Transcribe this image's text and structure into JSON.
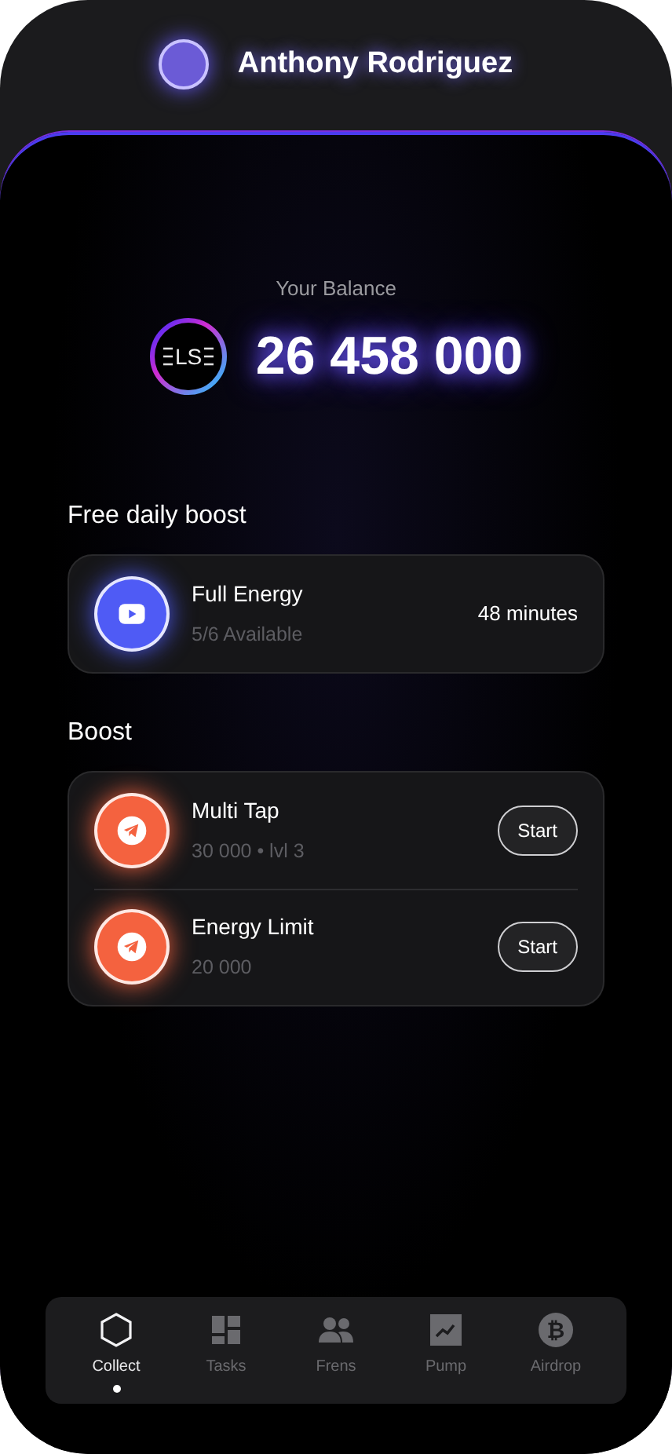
{
  "user": {
    "name": "Anthony Rodriguez"
  },
  "balance": {
    "label": "Your Balance",
    "coin_mark": "LS",
    "amount": "26 458 000"
  },
  "free_boost": {
    "title": "Free daily boost",
    "items": [
      {
        "kind": "timer",
        "color": "#4f5bf5",
        "title": "Full Energy",
        "subtitle": "5/6 Available",
        "status": "48 minutes"
      }
    ]
  },
  "boost": {
    "title": "Boost",
    "items": [
      {
        "kind": "button",
        "color": "#f4623f",
        "title": "Multi Tap",
        "subtitle": "30 000 • lvl 3",
        "action": "Start"
      },
      {
        "kind": "button",
        "color": "#f4623f",
        "title": "Energy Limit",
        "subtitle": "20 000",
        "action": "Start"
      }
    ]
  },
  "nav": [
    {
      "label": "Collect",
      "selected": true
    },
    {
      "label": "Tasks",
      "selected": false
    },
    {
      "label": "Frens",
      "selected": false
    },
    {
      "label": "Pump",
      "selected": false
    },
    {
      "label": "Airdrop",
      "selected": false,
      "icon_symbol": "₿"
    }
  ]
}
